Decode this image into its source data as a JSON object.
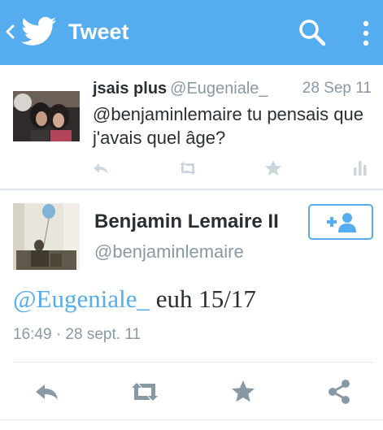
{
  "topbar": {
    "title": "Tweet",
    "color": "#55acee"
  },
  "reply_tweet": {
    "name": "jsais plus",
    "handle": "@Eugeniale_",
    "time": "28 Sep 11",
    "text": "@benjaminlemaire tu pensais que j'avais quel âge?"
  },
  "main_tweet": {
    "name": "Benjamin Lemaire II",
    "handle": "@benjaminlemaire",
    "mention": "@Eugeniale_",
    "text": " euh 15/17",
    "timestamp": "16:49 · 28 sept. 11"
  },
  "icons": {
    "back": "chevron-left-icon",
    "logo": "twitter-bird-icon",
    "search": "search-icon",
    "overflow": "overflow-menu-icon",
    "reply": "reply-icon",
    "retweet": "retweet-icon",
    "favorite": "star-icon",
    "stats": "bar-chart-icon",
    "share": "share-icon",
    "follow": "add-person-icon"
  }
}
